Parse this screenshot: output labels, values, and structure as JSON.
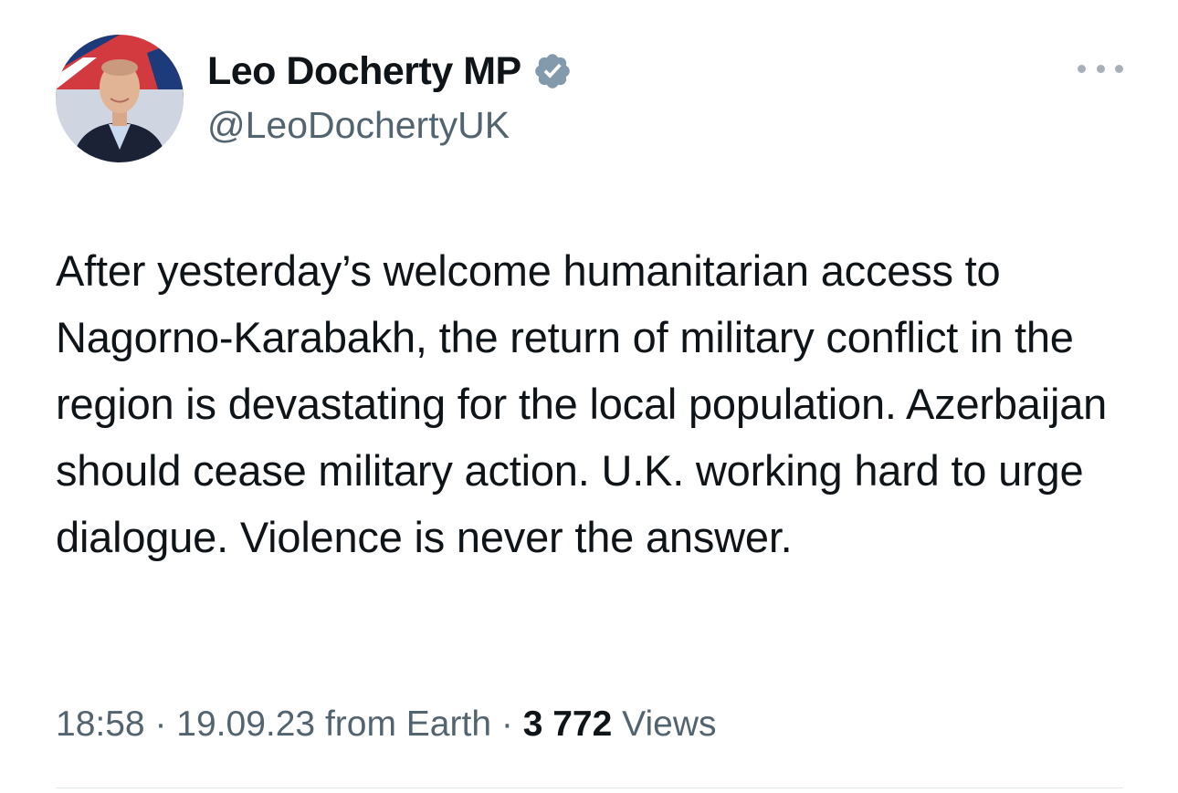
{
  "author": {
    "display_name": "Leo Docherty MP",
    "handle": "@LeoDochertyUK",
    "verified": true
  },
  "tweet": {
    "text": "After yesterday’s welcome humanitarian access to Nagorno-Karabakh, the return of military conflict in the region is devastating for the local population. Azerbaijan should cease military action. U.K. working hard to urge dialogue. Violence is never the answer."
  },
  "meta": {
    "time": "18:58",
    "date": "19.09.23",
    "source": "from Earth",
    "separator": "·",
    "views_count": "3 772",
    "views_label": "Views"
  },
  "icons": {
    "verified": "verified-badge-icon",
    "more": "more-options-icon"
  },
  "colors": {
    "text_primary": "#0f1419",
    "text_secondary": "#536471",
    "verified_badge": "#829aab"
  }
}
